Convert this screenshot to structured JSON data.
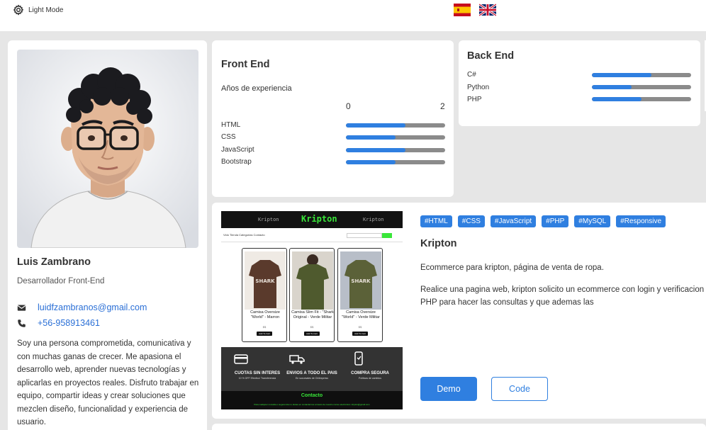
{
  "header": {
    "mode_label": "Light Mode",
    "languages": [
      {
        "name": "Spanish",
        "icon": "spain-flag-icon"
      },
      {
        "name": "English",
        "icon": "uk-flag-icon"
      }
    ]
  },
  "profile": {
    "name": "Luis Zambrano",
    "role": "Desarrollador Front-End",
    "email": "luidfzambranos@gmail.com",
    "phone": "+56-958913461",
    "bio": "Soy una persona comprometida, comunicativa y con muchas ganas de crecer. Me apasiona el desarrollo web, aprender nuevas tecnologías y aplicarlas en proyectos reales. Disfruto trabajar en equipo, compartir ideas y crear soluciones que mezclen diseño, funcionalidad y experiencia de usuario."
  },
  "front_end": {
    "title": "Front End",
    "experience_label": "Años de experiencia",
    "scale_min": "0",
    "scale_max": "2",
    "skills": [
      {
        "name": "HTML",
        "level": 0.6
      },
      {
        "name": "CSS",
        "level": 0.5
      },
      {
        "name": "JavaScript",
        "level": 0.6
      },
      {
        "name": "Bootstrap",
        "level": 0.5
      }
    ]
  },
  "back_end": {
    "title": "Back End",
    "skills": [
      {
        "name": "C#",
        "level": 0.6
      },
      {
        "name": "Python",
        "level": 0.4
      },
      {
        "name": "PHP",
        "level": 0.5
      }
    ]
  },
  "project": {
    "tags": [
      "#HTML",
      "#CSS",
      "#JavaScript",
      "#PHP",
      "#MySQL",
      "#Responsive"
    ],
    "title": "Kripton",
    "description": "Ecommerce para kripton, página de venta de ropa.",
    "long_description": "Realice una pagina web, kripton solicito un ecommerce con login y verificacion esta proyecto utilice MySQL y PHP para hacer las consultas y que ademas las",
    "demo_label": "Demo",
    "code_label": "Code",
    "screenshot": {
      "logo": "Kripton",
      "side_left": "Kripton",
      "side_right": "Kripton",
      "nav": "Vido  Tienda  Categorias  Contacto",
      "products": [
        {
          "name": "Camisa Oversize \"World\" - Marron",
          "price": "$$"
        },
        {
          "name": "Camisa Slim Fit - \"Shark Original - Verde Militar",
          "price": "$$"
        },
        {
          "name": "Camisa Oversize \"World\" - Verde Militar",
          "price": "$$"
        }
      ],
      "cart_label": "Add To Cart",
      "features": [
        {
          "title": "CUOTAS SIN INTERES",
          "sub": "10 % OFF Efectivo/ Transferencia"
        },
        {
          "title": "ENVIOS A TODO EL PAIS",
          "sub": "En sucursales de Chilexpress"
        },
        {
          "title": "COMPRA SEGURA",
          "sub": "Politicas de cambios"
        }
      ],
      "contact_title": "Contacto",
      "contact_line": "Para cualquier consulta o sugerencia no dudes en contactarnos a través de nuestro correo electrónico: kripton@gmail.com"
    }
  },
  "colors": {
    "accent": "#2f7fe0",
    "bar_track": "#8b8b8b",
    "background": "#e6e6e6",
    "brand_green": "#39e639"
  }
}
